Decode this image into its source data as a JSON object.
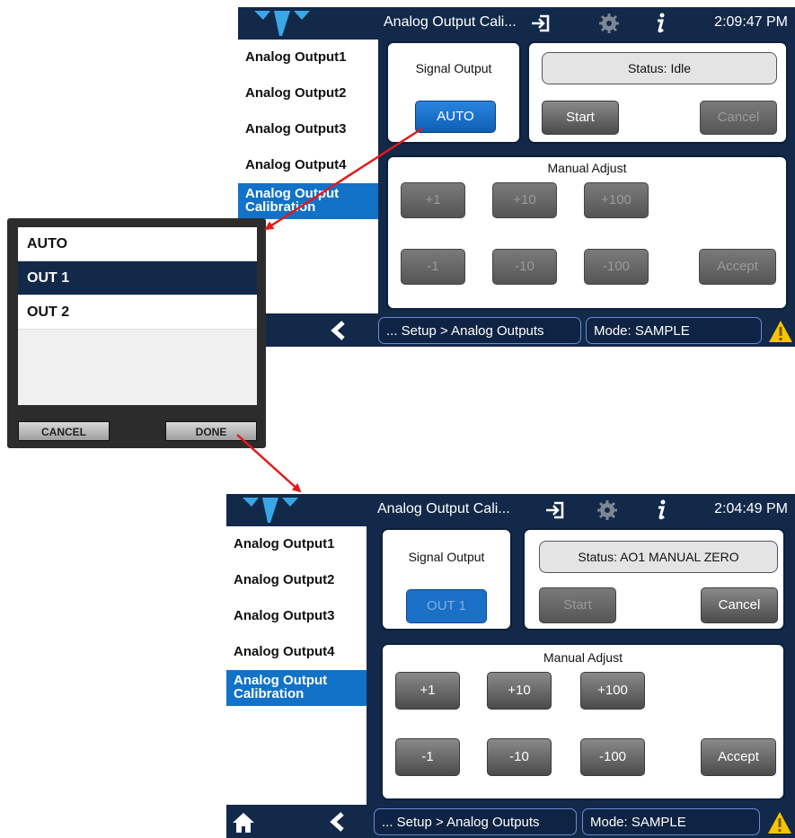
{
  "screen1": {
    "title": "Analog Output Cali...",
    "clock": "2:09:47 PM",
    "sidebar": [
      "Analog Output1",
      "Analog Output2",
      "Analog Output3",
      "Analog Output4",
      "Analog Output Calibration"
    ],
    "signal_output_label": "Signal Output",
    "signal_output_value": "AUTO",
    "status": "Status: Idle",
    "start_label": "Start",
    "cancel_label": "Cancel",
    "manual_adjust_label": "Manual Adjust",
    "adjust_buttons": [
      "+1",
      "+10",
      "+100",
      "-1",
      "-10",
      "-100"
    ],
    "accept_label": "Accept",
    "breadcrumb": "... Setup > Analog Outputs",
    "mode": "Mode: SAMPLE"
  },
  "popup": {
    "options": [
      "AUTO",
      "OUT 1",
      "OUT 2"
    ],
    "selected": "OUT 1",
    "cancel_label": "CANCEL",
    "done_label": "DONE"
  },
  "screen2": {
    "title": "Analog Output Cali...",
    "clock": "2:04:49 PM",
    "sidebar": [
      "Analog Output1",
      "Analog Output2",
      "Analog Output3",
      "Analog Output4",
      "Analog Output Calibration"
    ],
    "signal_output_label": "Signal Output",
    "signal_output_value": "OUT 1",
    "status": "Status: AO1 MANUAL ZERO",
    "start_label": "Start",
    "cancel_label": "Cancel",
    "manual_adjust_label": "Manual Adjust",
    "adjust_buttons": [
      "+1",
      "+10",
      "+100",
      "-1",
      "-10",
      "-100"
    ],
    "accept_label": "Accept",
    "breadcrumb": "... Setup > Analog Outputs",
    "mode": "Mode: SAMPLE"
  },
  "colors": {
    "navy": "#12294a",
    "accent_blue": "#1172c8",
    "arrow_red": "#e21a1a",
    "warning_yellow": "#f5c400"
  },
  "icons": [
    "teledyne-logo",
    "sign-in-icon",
    "gear-icon",
    "info-icon",
    "back-chevron-icon",
    "home-icon",
    "warning-icon"
  ]
}
